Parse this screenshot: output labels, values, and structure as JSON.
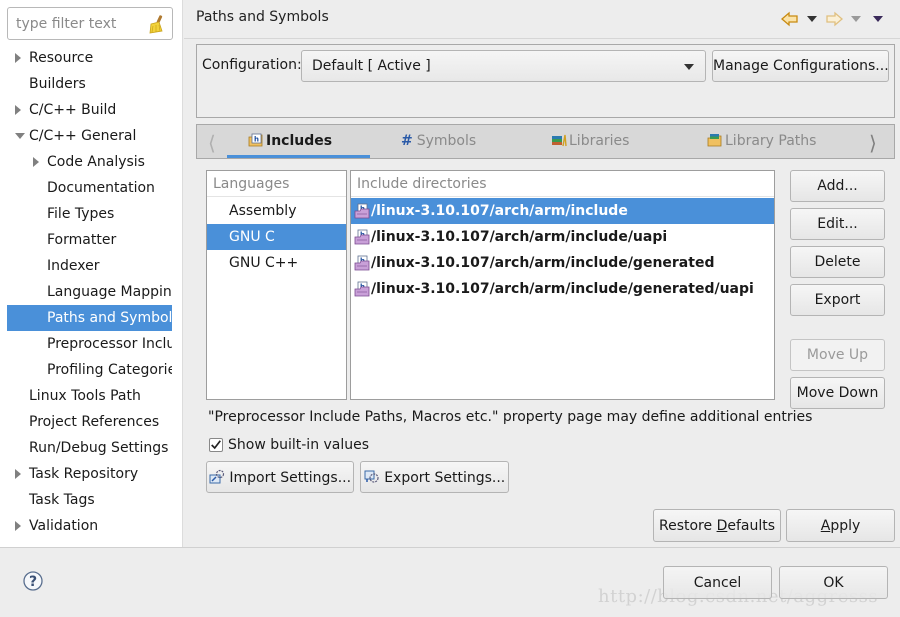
{
  "sidebar": {
    "filter_placeholder": "type filter text",
    "items": [
      {
        "label": "Resource",
        "twisty": "closed",
        "indent": 0
      },
      {
        "label": "Builders",
        "twisty": "none",
        "indent": 0
      },
      {
        "label": "C/C++ Build",
        "twisty": "closed",
        "indent": 0
      },
      {
        "label": "C/C++ General",
        "twisty": "open",
        "indent": 0
      },
      {
        "label": "Code Analysis",
        "twisty": "closed",
        "indent": 1
      },
      {
        "label": "Documentation",
        "twisty": "none",
        "indent": 1
      },
      {
        "label": "File Types",
        "twisty": "none",
        "indent": 1
      },
      {
        "label": "Formatter",
        "twisty": "none",
        "indent": 1
      },
      {
        "label": "Indexer",
        "twisty": "none",
        "indent": 1
      },
      {
        "label": "Language Mappings",
        "twisty": "none",
        "indent": 1
      },
      {
        "label": "Paths and Symbols",
        "twisty": "none",
        "indent": 1,
        "selected": true
      },
      {
        "label": "Preprocessor Include Paths, Macros etc.",
        "twisty": "none",
        "indent": 1
      },
      {
        "label": "Profiling Categories",
        "twisty": "none",
        "indent": 1
      },
      {
        "label": "Linux Tools Path",
        "twisty": "none",
        "indent": 0
      },
      {
        "label": "Project References",
        "twisty": "none",
        "indent": 0
      },
      {
        "label": "Run/Debug Settings",
        "twisty": "none",
        "indent": 0
      },
      {
        "label": "Task Repository",
        "twisty": "closed",
        "indent": 0
      },
      {
        "label": "Task Tags",
        "twisty": "none",
        "indent": 0
      },
      {
        "label": "Validation",
        "twisty": "closed",
        "indent": 0
      }
    ]
  },
  "header": {
    "title": "Paths and Symbols"
  },
  "config": {
    "label": "Configuration:",
    "selected": "Default  [ Active ]",
    "manage_button": "Manage Configurations..."
  },
  "tabs": [
    {
      "label": "Includes",
      "icon": "includes-icon",
      "active": true
    },
    {
      "label": "Symbols",
      "icon": "hash-icon"
    },
    {
      "label": "Libraries",
      "icon": "libraries-icon"
    },
    {
      "label": "Library Paths",
      "icon": "library-paths-icon"
    }
  ],
  "languages": {
    "header": "Languages",
    "items": [
      "Assembly",
      "GNU C",
      "GNU C++"
    ],
    "selected_index": 1
  },
  "includes": {
    "header": "Include directories",
    "items": [
      "/linux-3.10.107/arch/arm/include",
      "/linux-3.10.107/arch/arm/include/uapi",
      "/linux-3.10.107/arch/arm/include/generated",
      "/linux-3.10.107/arch/arm/include/generated/uapi"
    ],
    "selected_index": 0
  },
  "side_buttons": {
    "add": "Add...",
    "edit": "Edit...",
    "delete": "Delete",
    "export": "Export",
    "move_up": "Move Up",
    "move_down": "Move Down"
  },
  "info_text": "\"Preprocessor Include Paths, Macros etc.\" property page may define additional entries",
  "show_builtin": {
    "label": "Show built-in values",
    "checked": true
  },
  "import_settings": "Import Settings...",
  "export_settings": "Export Settings...",
  "restore_defaults": {
    "pre": "Restore ",
    "mnemonic": "D",
    "post": "efaults"
  },
  "apply": {
    "mnemonic": "A",
    "post": "pply"
  },
  "cancel": "Cancel",
  "ok": "OK",
  "watermark": "http://blog.csdn.net/aggresss",
  "colors": {
    "selection": "#4a90d9",
    "background": "#ededed"
  }
}
